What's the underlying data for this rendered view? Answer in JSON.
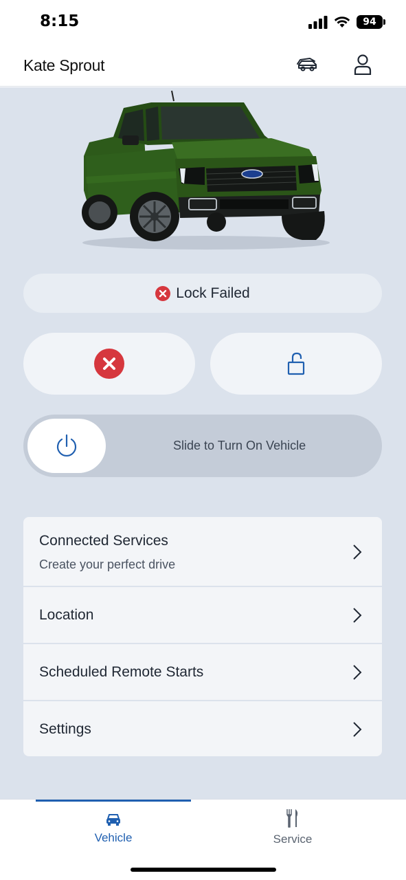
{
  "status_bar": {
    "time": "8:15",
    "battery": "94",
    "icons": [
      "signal-icon",
      "wifi-icon",
      "battery-icon"
    ]
  },
  "header": {
    "title": "Kate Sprout",
    "icons": [
      "vehicles-icon",
      "profile-icon"
    ]
  },
  "vehicle": {
    "image": "green-pickup-truck",
    "lock_status": "Lock Failed"
  },
  "actions": {
    "lock_icon": "error-x-icon",
    "unlock_icon": "unlock-icon"
  },
  "slider": {
    "label": "Slide to Turn On Vehicle",
    "icon": "power-icon"
  },
  "menu": {
    "items": [
      {
        "title": "Connected Services",
        "subtitle": "Create your perfect drive"
      },
      {
        "title": "Location"
      },
      {
        "title": "Scheduled Remote Starts"
      },
      {
        "title": "Settings"
      }
    ]
  },
  "bottom_nav": {
    "tabs": [
      {
        "label": "Vehicle",
        "icon": "car-icon",
        "active": true
      },
      {
        "label": "Service",
        "icon": "tools-icon",
        "active": false
      }
    ]
  },
  "colors": {
    "accent": "#1f5fb0",
    "error": "#d6373e",
    "background": "#dbe2ec",
    "vehicle_paint": "#2f5a1c"
  }
}
